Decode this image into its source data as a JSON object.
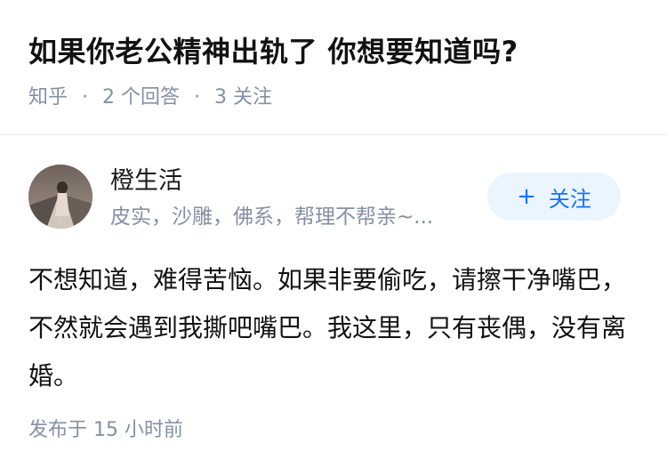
{
  "question": {
    "title": "如果你老公精神出轨了 你想要知道吗?",
    "source": "知乎",
    "answers": "2 个回答",
    "followers": "3 关注"
  },
  "author": {
    "avatar_icon": "user-avatar-photo",
    "name": "橙生活",
    "bio": "皮实，沙雕，佛系，帮理不帮亲~...",
    "follow_label": "关注",
    "follow_icon": "plus-icon",
    "accent_color": "#1772f6"
  },
  "answer": {
    "content": "不想知道，难得苦恼。如果非要偷吃，请擦干净嘴巴，不然就会遇到我撕吧嘴巴。我这里，只有丧偶，没有离婚。",
    "published": "发布于 15 小时前"
  }
}
